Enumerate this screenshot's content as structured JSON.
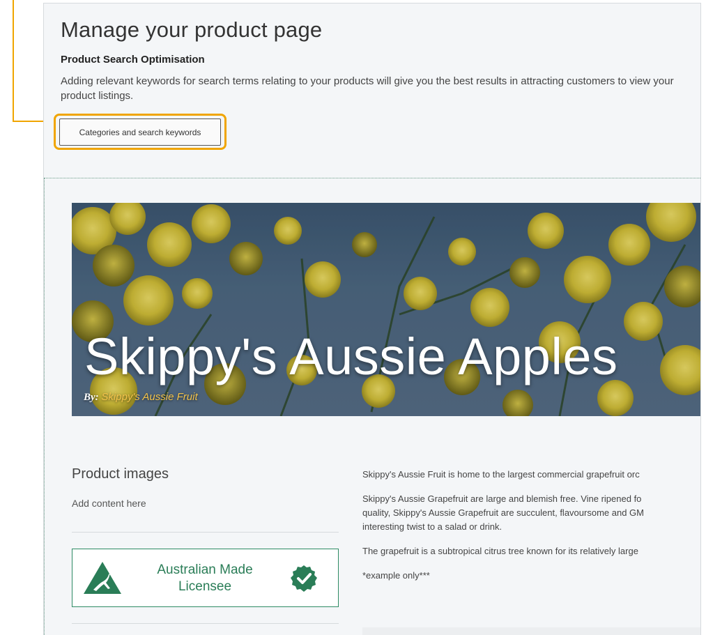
{
  "page": {
    "title": "Manage your product page"
  },
  "seo": {
    "title": "Product Search Optimisation",
    "description": "Adding relevant keywords for search terms relating to your products will give you the best results in attracting customers to view your product listings.",
    "keywords_button": "Categories and search keywords",
    "highlight_color": "#f0a500"
  },
  "hero": {
    "title": "Skippy's Aussie Apples",
    "by_label": "By:",
    "by_name": "Skippy's Aussie Fruit"
  },
  "product_images": {
    "heading": "Product images",
    "placeholder": "Add content here"
  },
  "badge": {
    "line1": "Australian Made",
    "line2": "Licensee",
    "icon_left": "kangaroo-triangle-icon",
    "icon_right": "check-circle-icon",
    "color": "#2a7d57"
  },
  "description": {
    "p1": "Skippy's Aussie Fruit is home to the largest commercial grapefruit orc",
    "p2": "Skippy's Aussie Grapefruit are large and blemish free. Vine ripened fo",
    "p2b": "quality, Skippy's Aussie Grapefruit are succulent, flavoursome and GM",
    "p2c": "interesting twist to a salad or drink.",
    "p3": "The grapefruit is a subtropical citrus tree known for its relatively large",
    "p4": "*example only***"
  }
}
